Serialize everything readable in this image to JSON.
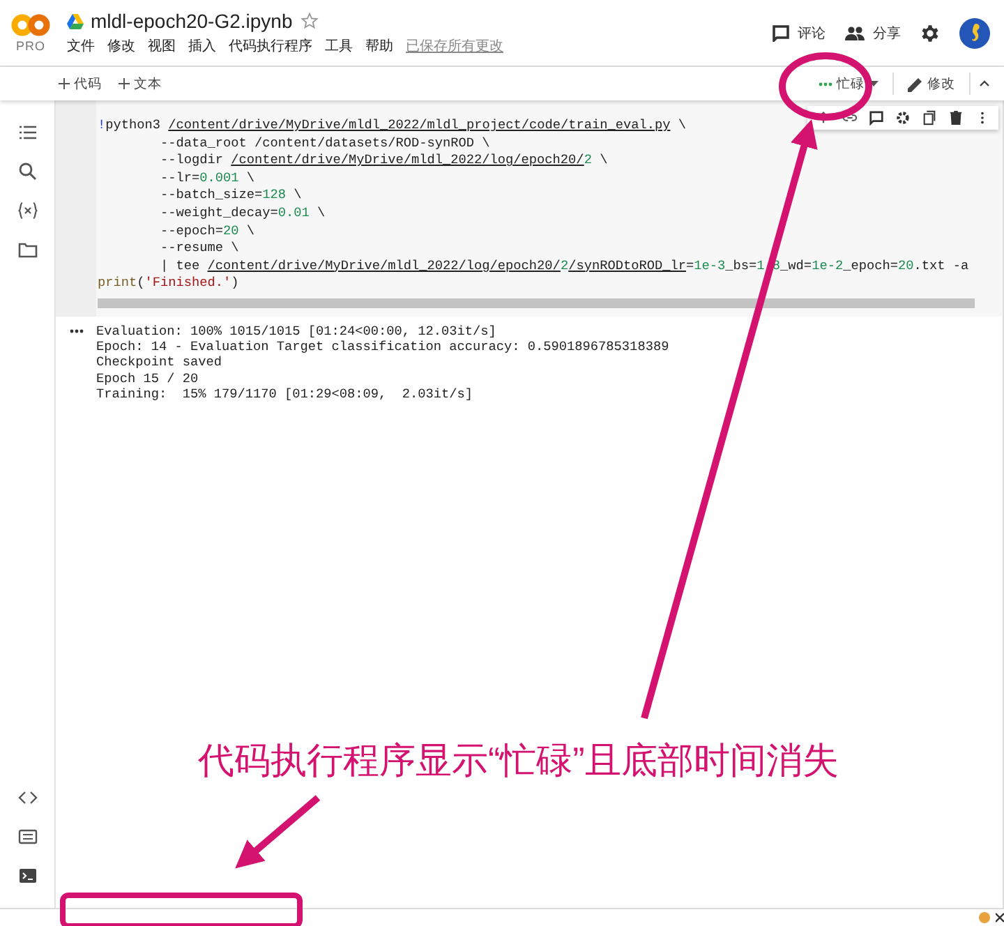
{
  "header": {
    "logo": {
      "text": "PRO"
    },
    "title": "mldl-epoch20-G2.ipynb",
    "menu": [
      "文件",
      "修改",
      "视图",
      "插入",
      "代码执行程序",
      "工具",
      "帮助"
    ],
    "save_status": "已保存所有更改",
    "actions": [
      {
        "kind": "comment",
        "label": "评论"
      },
      {
        "kind": "share",
        "label": "分享"
      }
    ]
  },
  "toolbar": {
    "insert": [
      "代码",
      "文本"
    ],
    "runtime": {
      "label": "忙碌",
      "busy": true
    },
    "edit": "修改"
  },
  "cell": {
    "code": [
      [
        {
          "kind": "bang",
          "text": "!"
        },
        {
          "kind": "plain",
          "text": "python3 "
        },
        {
          "kind": "path",
          "text": "/content/drive/MyDrive/mldl_2022/mldl_project/code/train_eval.py"
        },
        {
          "kind": "plain",
          "text": " \\"
        }
      ],
      [
        {
          "kind": "plain",
          "text": "        --data_root /content/datasets/ROD-synROD \\"
        }
      ],
      [
        {
          "kind": "plain",
          "text": "        --logdir "
        },
        {
          "kind": "path",
          "text": "/content/drive/MyDrive/mldl_2022/log/epoch20/"
        },
        {
          "kind": "num",
          "text": "2"
        },
        {
          "kind": "plain",
          "text": " \\"
        }
      ],
      [
        {
          "kind": "plain",
          "text": "        --lr="
        },
        {
          "kind": "num",
          "text": "0.001"
        },
        {
          "kind": "plain",
          "text": " \\"
        }
      ],
      [
        {
          "kind": "plain",
          "text": "        --batch_size="
        },
        {
          "kind": "num",
          "text": "128"
        },
        {
          "kind": "plain",
          "text": " \\"
        }
      ],
      [
        {
          "kind": "plain",
          "text": "        --weight_decay="
        },
        {
          "kind": "num",
          "text": "0.01"
        },
        {
          "kind": "plain",
          "text": " \\"
        }
      ],
      [
        {
          "kind": "plain",
          "text": "        --epoch="
        },
        {
          "kind": "num",
          "text": "20"
        },
        {
          "kind": "plain",
          "text": " \\"
        }
      ],
      [
        {
          "kind": "plain",
          "text": "        --resume \\"
        }
      ],
      [
        {
          "kind": "plain",
          "text": "        | tee "
        },
        {
          "kind": "path",
          "text": "/content/drive/MyDrive/mldl_2022/log/epoch20/"
        },
        {
          "kind": "num",
          "text": "2"
        },
        {
          "kind": "path",
          "text": "/synRODtoROD_lr"
        },
        {
          "kind": "plain",
          "text": "="
        },
        {
          "kind": "num",
          "text": "1e-3"
        },
        {
          "kind": "plain",
          "text": "_bs="
        },
        {
          "kind": "num",
          "text": "1"
        },
        {
          "kind": "gap"
        },
        {
          "kind": "num",
          "text": "8"
        },
        {
          "kind": "plain",
          "text": "_wd="
        },
        {
          "kind": "num",
          "text": "1e-2"
        },
        {
          "kind": "plain",
          "text": "_epoch="
        },
        {
          "kind": "num",
          "text": "20"
        },
        {
          "kind": "plain",
          "text": ".txt -a"
        }
      ],
      [
        {
          "kind": "func",
          "text": "print"
        },
        {
          "kind": "plain",
          "text": "("
        },
        {
          "kind": "str",
          "text": "'Finished.'"
        },
        {
          "kind": "plain",
          "text": ")"
        }
      ]
    ],
    "output": [
      "Evaluation: 100% 1015/1015 [01:24<00:00, 12.03it/s]",
      "Epoch: 14 - Evaluation Target classification accuracy: 0.5901896785318389",
      "Checkpoint saved",
      "Epoch 15 / 20",
      "Training:  15% 179/1170 [01:29<08:09,  2.03it/s]"
    ]
  },
  "annotation": {
    "caption": "代码执行程序显示“忙碌”且底部时间消失"
  }
}
